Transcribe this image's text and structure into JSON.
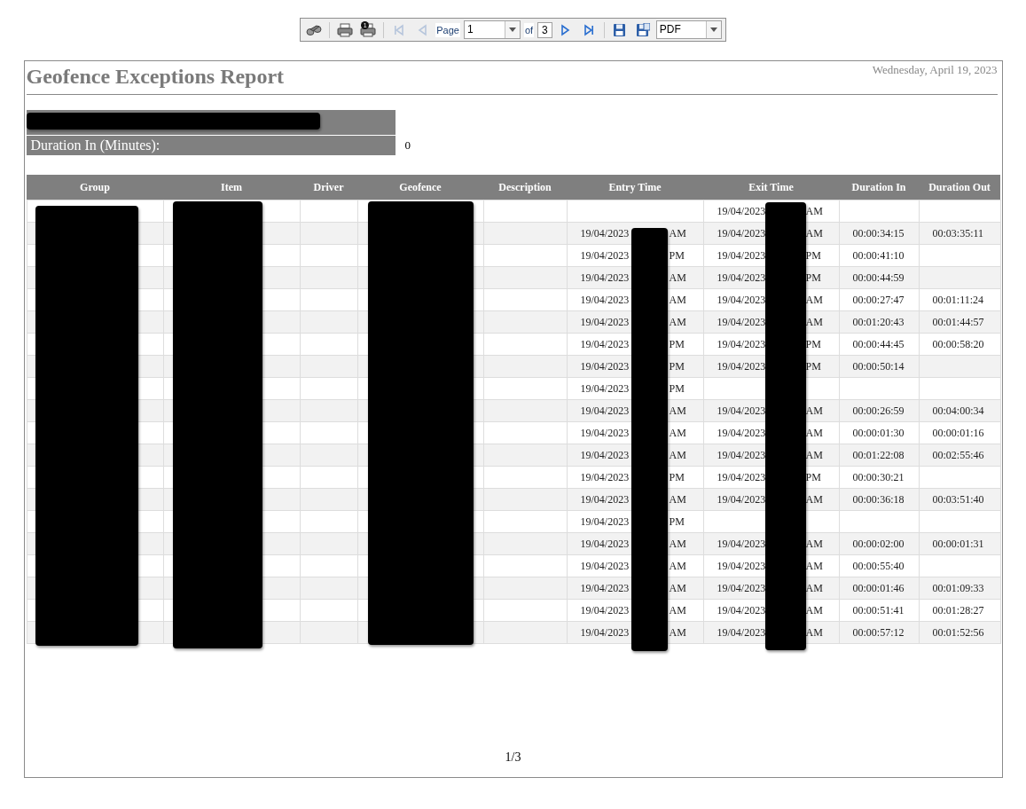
{
  "toolbar": {
    "print_badge": "1",
    "page_label": "Page",
    "page_value": "1",
    "of_label": "of",
    "page_count": "3",
    "format": "PDF",
    "nav": [
      {
        "kind": "first",
        "disabled": true
      },
      {
        "kind": "previous",
        "disabled": true
      },
      {
        "kind": "next",
        "disabled": false
      },
      {
        "kind": "last",
        "disabled": false
      }
    ]
  },
  "report": {
    "title": "Geofence Exceptions Report",
    "date": "Wednesday, April 19, 2023",
    "filters": [
      {
        "label": "Duration In (Minutes):",
        "value": "0"
      }
    ],
    "columns": [
      "Group",
      "Item",
      "Driver",
      "Geofence",
      "Description",
      "Entry Time",
      "Exit Time",
      "Duration In",
      "Duration Out"
    ],
    "rows": [
      {
        "exit": [
          "19/04/2023",
          "AM"
        ]
      },
      {
        "entry": [
          "19/04/2023",
          "AM"
        ],
        "exit": [
          "19/04/2023",
          "AM"
        ],
        "duration_in": "00:00:34:15",
        "duration_out": "00:03:35:11"
      },
      {
        "entry": [
          "19/04/2023",
          "PM"
        ],
        "exit": [
          "19/04/2023",
          "PM"
        ],
        "duration_in": "00:00:41:10"
      },
      {
        "entry": [
          "19/04/2023",
          "AM"
        ],
        "exit": [
          "19/04/2023",
          "PM"
        ],
        "duration_in": "00:00:44:59"
      },
      {
        "entry": [
          "19/04/2023",
          "AM"
        ],
        "exit": [
          "19/04/2023",
          "AM"
        ],
        "duration_in": "00:00:27:47",
        "duration_out": "00:01:11:24"
      },
      {
        "entry": [
          "19/04/2023",
          "AM"
        ],
        "exit": [
          "19/04/2023",
          "AM"
        ],
        "duration_in": "00:01:20:43",
        "duration_out": "00:01:44:57"
      },
      {
        "entry": [
          "19/04/2023",
          "PM"
        ],
        "exit": [
          "19/04/2023",
          "PM"
        ],
        "duration_in": "00:00:44:45",
        "duration_out": "00:00:58:20"
      },
      {
        "entry": [
          "19/04/2023",
          "PM"
        ],
        "exit": [
          "19/04/2023",
          "PM"
        ],
        "duration_in": "00:00:50:14"
      },
      {
        "entry": [
          "19/04/2023",
          "PM"
        ]
      },
      {
        "entry": [
          "19/04/2023",
          "AM"
        ],
        "exit": [
          "19/04/2023",
          "AM"
        ],
        "duration_in": "00:00:26:59",
        "duration_out": "00:04:00:34"
      },
      {
        "entry": [
          "19/04/2023",
          "AM"
        ],
        "exit": [
          "19/04/2023",
          "AM"
        ],
        "duration_in": "00:00:01:30",
        "duration_out": "00:00:01:16"
      },
      {
        "entry": [
          "19/04/2023",
          "AM"
        ],
        "exit": [
          "19/04/2023",
          "AM"
        ],
        "duration_in": "00:01:22:08",
        "duration_out": "00:02:55:46"
      },
      {
        "entry": [
          "19/04/2023",
          "PM"
        ],
        "exit": [
          "19/04/2023",
          "PM"
        ],
        "duration_in": "00:00:30:21"
      },
      {
        "entry": [
          "19/04/2023",
          "AM"
        ],
        "exit": [
          "19/04/2023",
          "AM"
        ],
        "duration_in": "00:00:36:18",
        "duration_out": "00:03:51:40"
      },
      {
        "entry": [
          "19/04/2023",
          "PM"
        ]
      },
      {
        "entry": [
          "19/04/2023",
          "AM"
        ],
        "exit": [
          "19/04/2023",
          "AM"
        ],
        "duration_in": "00:00:02:00",
        "duration_out": "00:00:01:31"
      },
      {
        "entry": [
          "19/04/2023",
          "AM"
        ],
        "exit": [
          "19/04/2023",
          "AM"
        ],
        "duration_in": "00:00:55:40"
      },
      {
        "entry": [
          "19/04/2023",
          "AM"
        ],
        "exit": [
          "19/04/2023",
          "AM"
        ],
        "duration_in": "00:00:01:46",
        "duration_out": "00:01:09:33"
      },
      {
        "entry": [
          "19/04/2023",
          "AM"
        ],
        "exit": [
          "19/04/2023",
          "AM"
        ],
        "duration_in": "00:00:51:41",
        "duration_out": "00:01:28:27"
      },
      {
        "entry": [
          "19/04/2023",
          "AM"
        ],
        "exit": [
          "19/04/2023",
          "AM"
        ],
        "duration_in": "00:00:57:12",
        "duration_out": "00:01:52:56"
      }
    ],
    "page_footer": "1/3"
  }
}
